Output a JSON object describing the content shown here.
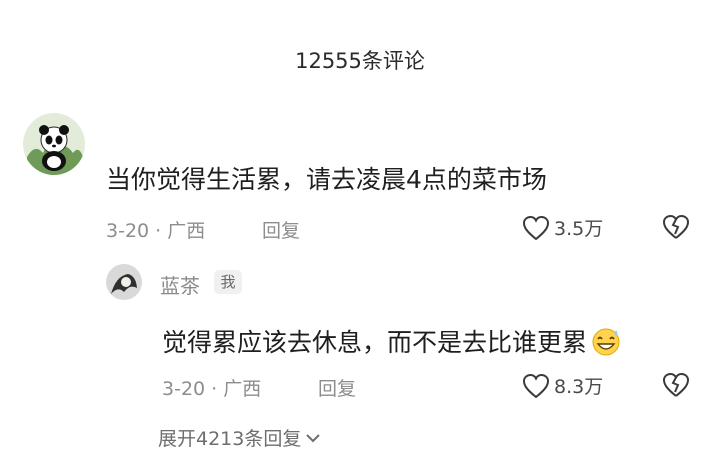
{
  "header": {
    "comment_count_title": "12555条评论"
  },
  "comment": {
    "text": "当你觉得生活累，请去凌晨4点的菜市场",
    "date": "3-20",
    "location": "广西",
    "reply_label": "回复",
    "likes": "3.5万",
    "avatar_icon": "panda-avatar-icon",
    "like_icon": "heart-outline-icon",
    "dislike_icon": "broken-heart-icon"
  },
  "reply": {
    "username": "蓝茶",
    "me_badge": "我",
    "text": "觉得累应该去休息，而不是去比谁更累",
    "emoji_icon": "sweat-smile-emoji-icon",
    "date": "3-20",
    "location": "广西",
    "reply_label": "回复",
    "likes": "8.3万"
  },
  "expand": {
    "label": "展开4213条回复",
    "icon": "chevron-down-icon"
  },
  "colors": {
    "text": "#1f1f1f",
    "meta": "#8d8d8d",
    "background": "#ffffff"
  }
}
